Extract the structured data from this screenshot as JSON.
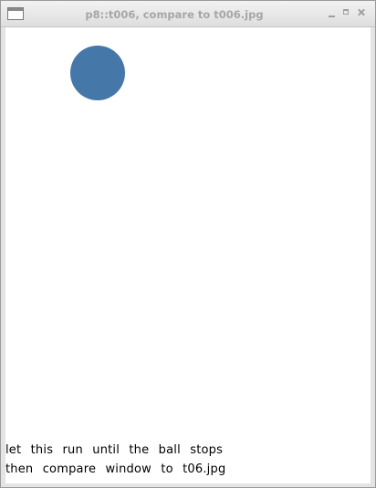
{
  "window": {
    "title": "p8::t006, compare to t006.jpg"
  },
  "canvas": {
    "background": "#ffffff",
    "ball_color": "#4577a8",
    "message_line1": "let this run until the ball stops",
    "message_line2": "then compare window to t06.jpg"
  },
  "icons": {
    "app": "window-icon",
    "minimize": "minimize-icon",
    "maximize": "maximize-icon",
    "close": "close-icon"
  }
}
